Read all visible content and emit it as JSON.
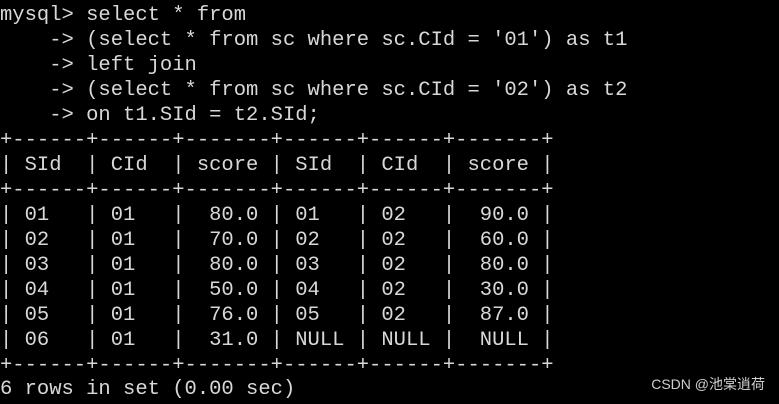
{
  "terminal": {
    "lines": [
      "mysql> select * from",
      "    -> (select * from sc where sc.CId = '01') as t1",
      "    -> left join",
      "    -> (select * from sc where sc.CId = '02') as t2",
      "    -> on t1.SId = t2.SId;",
      "+------+------+-------+------+------+-------+",
      "| SId  | CId  | score | SId  | CId  | score |",
      "+------+------+-------+------+------+-------+",
      "| 01   | 01   |  80.0 | 01   | 02   |  90.0 |",
      "| 02   | 01   |  70.0 | 02   | 02   |  60.0 |",
      "| 03   | 01   |  80.0 | 03   | 02   |  80.0 |",
      "| 04   | 01   |  50.0 | 04   | 02   |  30.0 |",
      "| 05   | 01   |  76.0 | 05   | 02   |  87.0 |",
      "| 06   | 01   |  31.0 | NULL | NULL |  NULL |",
      "+------+------+-------+------+------+-------+",
      "6 rows in set (0.00 sec)"
    ]
  },
  "watermark": "CSDN @池棠逍荷",
  "colors": {
    "background": "#000000",
    "text": "#d8d8d8"
  }
}
